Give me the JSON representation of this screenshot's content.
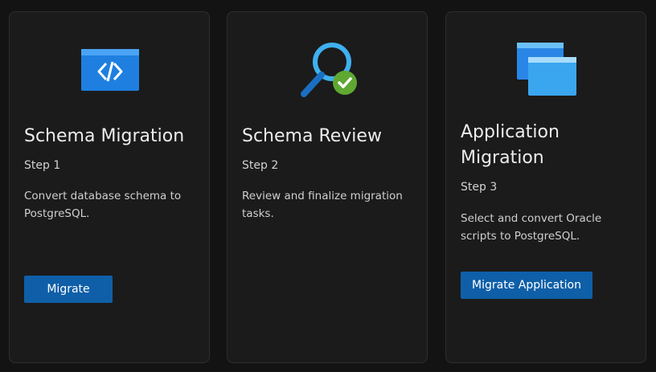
{
  "cards": [
    {
      "title": "Schema Migration",
      "step": "Step 1",
      "description": "Convert database schema to PostgreSQL.",
      "icon": "code-window-icon",
      "button_label": "Migrate"
    },
    {
      "title": "Schema Review",
      "step": "Step 2",
      "description": "Review and finalize migration tasks.",
      "icon": "magnifier-check-icon"
    },
    {
      "title": "Application Migration",
      "step": "Step 3",
      "description": "Select and convert Oracle scripts to PostgreSQL.",
      "icon": "stacked-windows-icon",
      "button_label": "Migrate Application"
    }
  ],
  "colors": {
    "background": "#131313",
    "card": "#1b1b1b",
    "button": "#0f5fa8",
    "icon_blue": "#1e7fe0",
    "check_green": "#5fa832"
  }
}
